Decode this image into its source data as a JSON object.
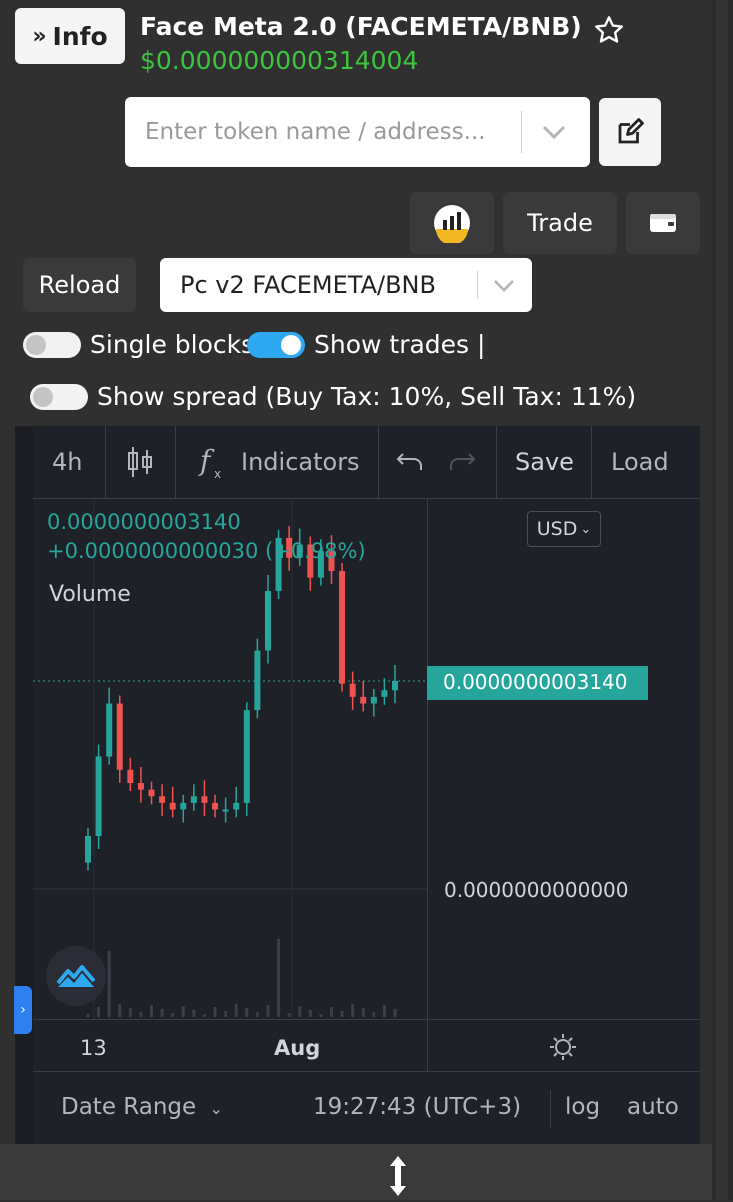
{
  "header": {
    "info_label": "Info",
    "token_title": "Face Meta 2.0 (FACEMETA/BNB)",
    "price": "$0.000000000314004"
  },
  "search": {
    "placeholder": "Enter token name / address..."
  },
  "actions": {
    "trade_label": "Trade"
  },
  "controls": {
    "reload_label": "Reload",
    "pair_select": "Pc v2 FACEMETA/BNB",
    "single_blocks_label": "Single blocks",
    "single_blocks_on": false,
    "show_trades_label": "Show trades |",
    "show_trades_on": true,
    "show_spread_label": "Show spread (Buy Tax: 10%, Sell Tax: 11%)",
    "show_spread_on": false
  },
  "chart_toolbar": {
    "interval": "4h",
    "indicators_label": "Indicators",
    "save_label": "Save",
    "load_label": "Load"
  },
  "chart": {
    "last_value": "0.0000000003140",
    "change": "+0.0000000000030 (+0.98%)",
    "volume_label": "Volume",
    "currency": "USD",
    "price_tag": "0.0000000003140",
    "zero_label": "0.0000000000000",
    "x_ticks": [
      "13",
      "Aug"
    ],
    "date_range_label": "Date Range",
    "clock": "19:27:43 (UTC+3)",
    "log_label": "log",
    "auto_label": "auto"
  },
  "colors": {
    "up": "#26a69a",
    "down": "#ef5350",
    "price_green": "#3ec33e",
    "toggle_on": "#2ea8f0"
  },
  "chart_data": {
    "type": "candlestick",
    "x": [
      "13",
      "Aug"
    ],
    "values": [
      8e-11,
      2e-10,
      2.8e-10,
      1.8e-10,
      1.6e-10,
      1.5e-10,
      1.4e-10,
      1.3e-10,
      1.2e-10,
      1.3e-10,
      1.4e-10,
      1.3e-10,
      1.2e-10,
      1.2e-10,
      1.3e-10,
      2.7e-10,
      3.6e-10,
      4.5e-10,
      5.3e-10,
      5e-10,
      5.2e-10,
      4.7e-10,
      5.1e-10,
      4.8e-10,
      3.1e-10,
      2.9e-10,
      2.8e-10,
      2.9e-10,
      3e-10,
      3.14e-10
    ],
    "ylim": [
      0,
      3.14e-10
    ]
  }
}
